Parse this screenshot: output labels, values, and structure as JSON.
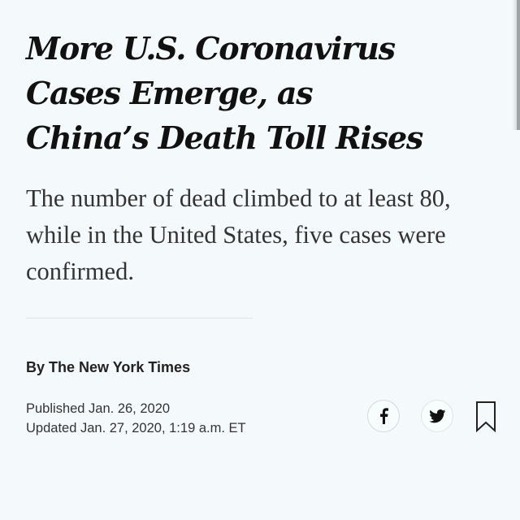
{
  "article": {
    "headline_lines": [
      "More U.S. Coronavirus",
      "Cases Emerge, as",
      "China’s Death Toll Rises"
    ],
    "summary_lines": [
      "The number of dead climbed to at least 80,",
      "while in the United States, five cases were",
      "confirmed."
    ],
    "byline": "By The New York Times",
    "published": "Published Jan. 26, 2020",
    "updated": "Updated Jan. 27, 2020, 1:19 a.m. ET"
  },
  "actions": {
    "share_facebook_icon": "facebook-icon",
    "share_twitter_icon": "twitter-icon",
    "save_icon": "bookmark-icon"
  },
  "colors": {
    "background": "#f4fafb",
    "headline": "#111111",
    "summary": "#333333",
    "divider": "#dfe3e4"
  }
}
